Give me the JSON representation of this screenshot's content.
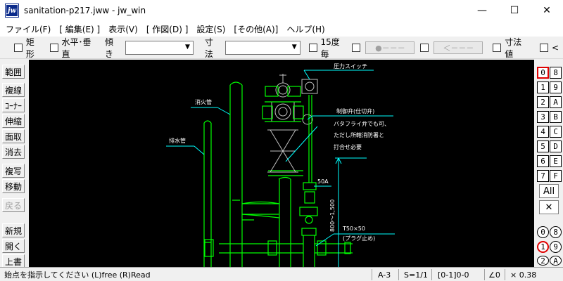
{
  "window": {
    "app_icon": "jw",
    "title": "sanitation-p217.jww - jw_win",
    "controls": {
      "minimize": "—",
      "maximize": "☐",
      "close": "✕"
    }
  },
  "menu": [
    "ファイル(F)",
    "[ 編集(E) ]",
    "表示(V)",
    "[ 作図(D) ]",
    "設定(S)",
    "[その他(A)]",
    "ヘルプ(H)"
  ],
  "toolbar": {
    "rect_label": "矩形",
    "hv_label": "水平･垂直",
    "tilt_label": "傾き",
    "tilt_value": "",
    "dim_label": "寸法",
    "dim_value": "",
    "deg15_label": "15度毎",
    "btn_a": "●－－－",
    "btn_b": "＜－－－",
    "dimval_label": "寸法値",
    "lt_label": "<"
  },
  "left_buttons": [
    {
      "label": "範囲",
      "enabled": true
    },
    {
      "label": "複線",
      "enabled": true
    },
    {
      "label": "ｺｰﾅｰ",
      "enabled": true
    },
    {
      "label": "伸縮",
      "enabled": true
    },
    {
      "label": "面取",
      "enabled": true
    },
    {
      "label": "消去",
      "enabled": true
    },
    {
      "label": "複写",
      "enabled": true
    },
    {
      "label": "移動",
      "enabled": true
    },
    {
      "label": "戻る",
      "enabled": false
    },
    {
      "label": "新規",
      "enabled": true
    },
    {
      "label": "開く",
      "enabled": true
    },
    {
      "label": "上書",
      "enabled": true
    }
  ],
  "layers": {
    "rows": [
      [
        "0",
        "8"
      ],
      [
        "1",
        "9"
      ],
      [
        "2",
        "A"
      ],
      [
        "3",
        "B"
      ],
      [
        "4",
        "C"
      ],
      [
        "5",
        "D"
      ],
      [
        "6",
        "E"
      ],
      [
        "7",
        "F"
      ]
    ],
    "active": "0",
    "all_label": "All",
    "cross_label": "✕",
    "groups": [
      [
        "0",
        "8"
      ],
      [
        "1",
        "9"
      ],
      [
        "2",
        "A"
      ]
    ],
    "active_group": "1"
  },
  "drawing": {
    "labels": {
      "pressure_switch": "圧力スイッチ",
      "fire_pipe": "消火管",
      "drain_pipe": "排水管",
      "control_valve": "制御弁(仕切弁)",
      "note1": "バタフライ弁でも可、",
      "note2": "ただし所轄消防署と",
      "note3": "打合せ必要",
      "size_50a": "50A",
      "height_dim": "800～1,500",
      "t50": "T50×50",
      "plug": "(プラグ止め)"
    },
    "colors": {
      "pipe": "#00ff00",
      "line": "#00ffff",
      "text": "#ffffff",
      "dim": "#00ffff",
      "background": "#000000"
    }
  },
  "status": {
    "message": "始点を指示してください (L)free (R)Read",
    "paper": "A-3",
    "scale": "S=1/1",
    "layer": "[0-1]0-0",
    "angle": "∠0",
    "zoom": "× 0.38"
  }
}
